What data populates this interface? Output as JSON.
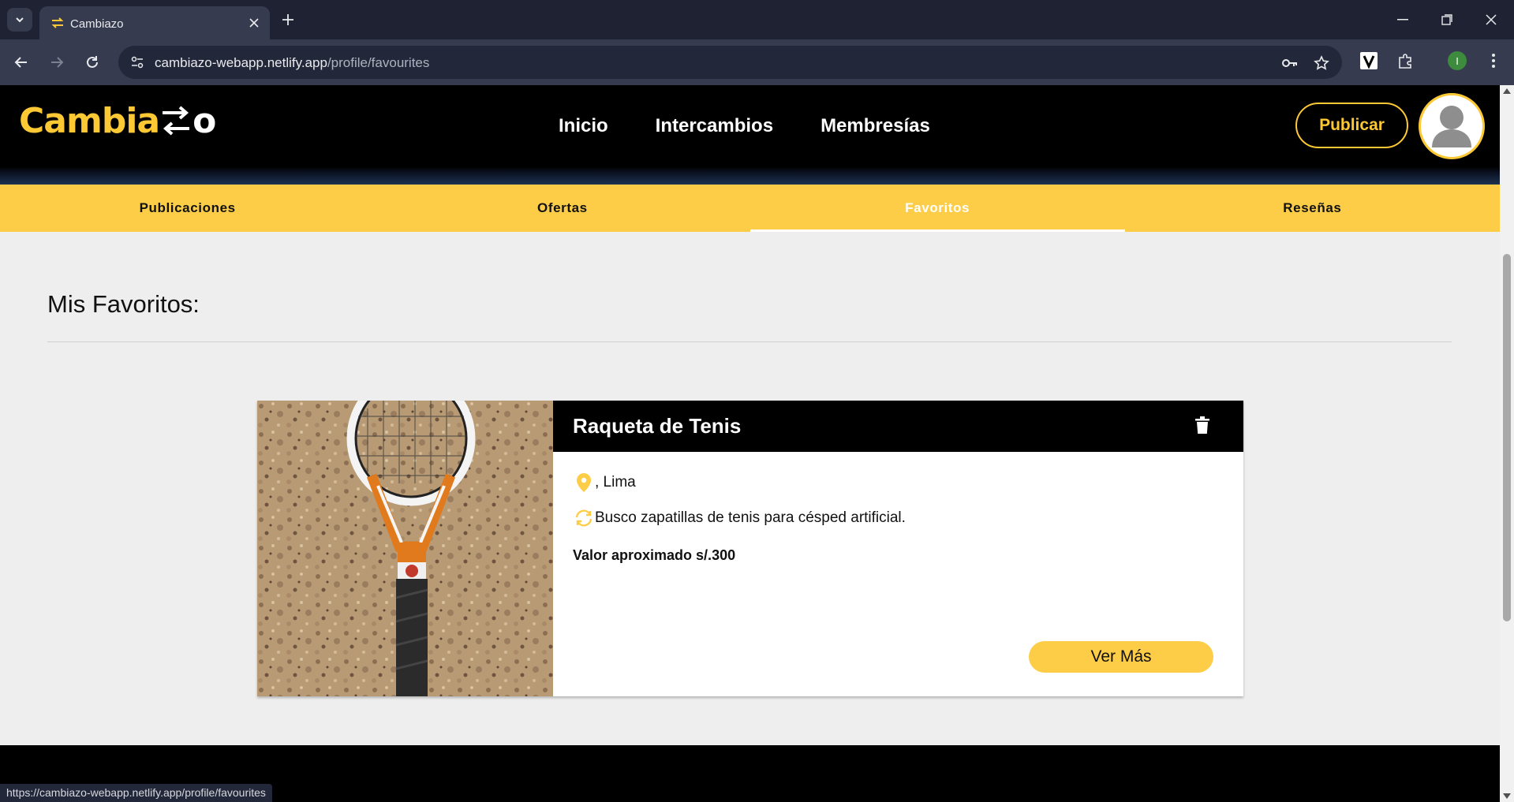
{
  "browser": {
    "tab_title": "Cambiazo",
    "url_host": "cambiazo-webapp.netlify.app",
    "url_path": "/profile/favourites",
    "profile_initial": "I",
    "status_url": "https://cambiazo-webapp.netlify.app/profile/favourites"
  },
  "header": {
    "logo_text": "Cambia",
    "logo_suffix": "o",
    "nav": [
      "Inicio",
      "Intercambios",
      "Membresías"
    ],
    "publish_label": "Publicar"
  },
  "profile_tabs": {
    "items": [
      "Publicaciones",
      "Ofertas",
      "Favoritos",
      "Reseñas"
    ],
    "active": "Favoritos"
  },
  "main": {
    "title": "Mis Favoritos:",
    "favorites": [
      {
        "title": "Raqueta de Tenis",
        "location": ", Lima",
        "wants": "Busco zapatillas de tenis para césped artificial.",
        "value": "Valor aproximado s/.300",
        "button": "Ver Más"
      }
    ]
  },
  "colors": {
    "brand_yellow": "#fdcd47",
    "header_bg": "#000000",
    "content_bg": "#eeeeee"
  }
}
